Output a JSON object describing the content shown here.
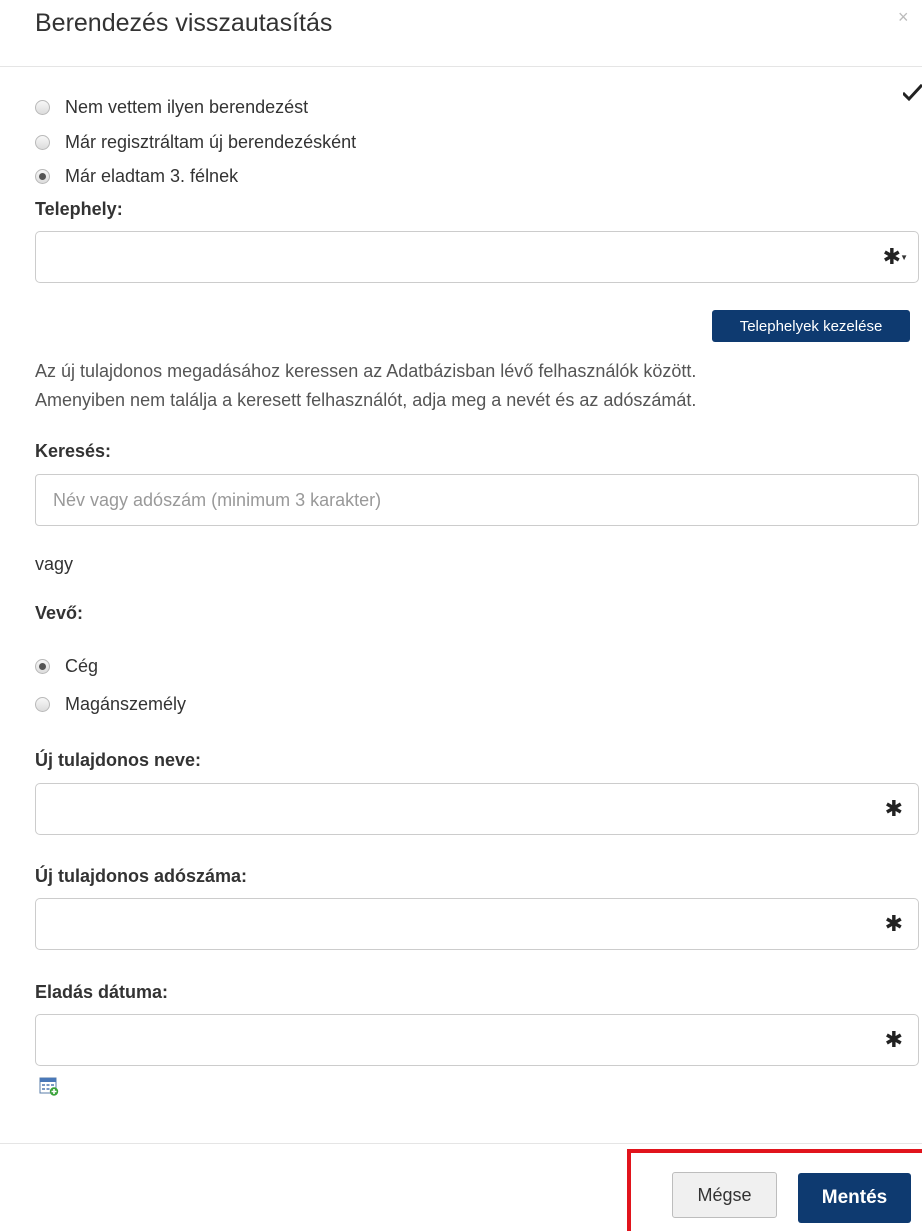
{
  "dialog": {
    "title": "Berendezés visszautasítás",
    "close_icon": "close-icon",
    "close_glyph": "×",
    "status_icon": "checkmark-icon"
  },
  "rejection_reasons": {
    "options": [
      {
        "label": "Nem vettem ilyen berendezést",
        "checked": false
      },
      {
        "label": "Már regisztráltam új berendezésként",
        "checked": false
      },
      {
        "label": "Már eladtam 3. félnek",
        "checked": true
      }
    ]
  },
  "site": {
    "label": "Telephely:",
    "value": "",
    "required_marker": "✱",
    "dropdown_icon": "caret-down-icon",
    "manage_button": "Telephelyek kezelése"
  },
  "info": {
    "line1": "Az új tulajdonos megadásához keressen az Adatbázisban lévő felhasználók között.",
    "line2": "Amenyiben nem találja a keresett felhasználót, adja meg a nevét és az adószámát."
  },
  "search": {
    "label": "Keresés:",
    "placeholder": "Név vagy adószám (minimum 3 karakter)",
    "value": ""
  },
  "or_text": "vagy",
  "buyer": {
    "label": "Vevő:",
    "options": [
      {
        "label": "Cég",
        "checked": true
      },
      {
        "label": "Magánszemély",
        "checked": false
      }
    ]
  },
  "owner_name": {
    "label": "Új tulajdonos neve:",
    "value": "",
    "required_marker": "✱"
  },
  "owner_tax": {
    "label": "Új tulajdonos adószáma:",
    "value": "",
    "required_marker": "✱"
  },
  "sale_date": {
    "label": "Eladás dátuma:",
    "value": "",
    "required_marker": "✱",
    "calendar_icon": "calendar-icon"
  },
  "footer": {
    "cancel_label": "Mégse",
    "save_label": "Mentés"
  },
  "colors": {
    "primary": "#0e3a70",
    "highlight": "#e1141c"
  }
}
